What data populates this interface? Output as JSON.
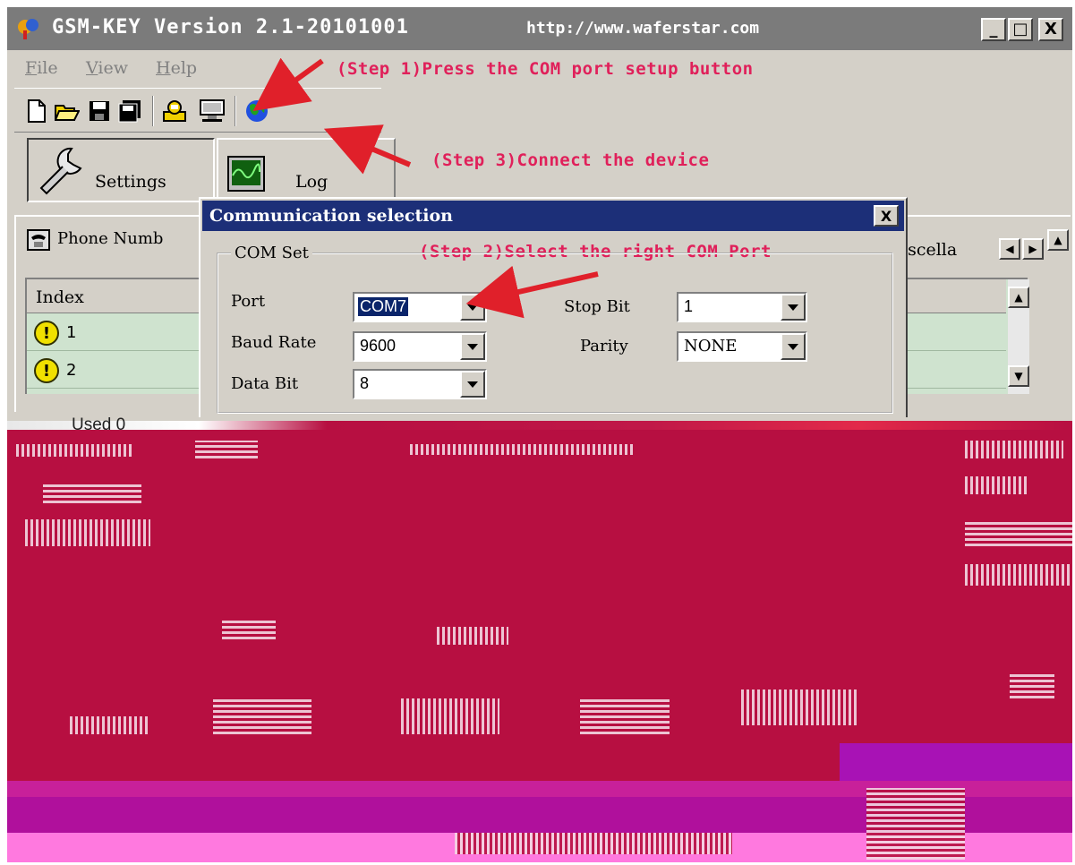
{
  "window": {
    "title": "GSM-KEY Version 2.1-20101001",
    "url": "http://www.waferstar.com",
    "controls": [
      "_",
      "□",
      "X"
    ]
  },
  "menu": [
    "File",
    "View",
    "Help"
  ],
  "annotations": {
    "step1": "(Step 1)Press the COM port setup button",
    "step2": "(Step 2)Select the right COM Port",
    "step3": "(Step 3)Connect the device"
  },
  "toolbar": {
    "icons": [
      "new-file-icon",
      "open-folder-icon",
      "save-icon",
      "save-all-icon",
      "com-setup-icon",
      "connect-device-icon",
      "globe-icon"
    ]
  },
  "side_tabs": {
    "settings": "Settings",
    "log": "Log"
  },
  "phone_tab": "Phone Numb",
  "misc_tab": "iscella",
  "grid": {
    "header": "Index",
    "rows": [
      "1",
      "2"
    ]
  },
  "used_label": "Used 0",
  "dialog": {
    "title": "Communication selection",
    "close": "X",
    "group": "COM Set",
    "port_label": "Port",
    "port_value": "COM7",
    "baud_label": "Baud Rate",
    "baud_value": "9600",
    "databit_label": "Data Bit",
    "databit_value": "8",
    "stopbit_label": "Stop Bit",
    "stopbit_value": "1",
    "parity_label": "Parity",
    "parity_value": "NONE"
  },
  "colors": {
    "annotation": "#e0205a",
    "dialog_title_bg": "#1c2f78",
    "titlebar_bg": "#7b7b7b",
    "grid_bg": "#cfe3cf",
    "glitch": "#b70f41"
  }
}
